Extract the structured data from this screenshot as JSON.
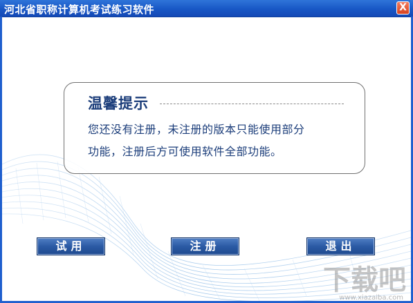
{
  "window": {
    "title": "河北省职称计算机考试练习软件",
    "close_label": "X"
  },
  "tip": {
    "title": "温馨提示",
    "line1": "您还没有注册，未注册的版本只能使用部分",
    "line2": "功能，注册后方可使用软件全部功能。"
  },
  "buttons": {
    "trial": "试用",
    "register": "注册",
    "exit": "退出"
  },
  "watermark": {
    "text": "下载吧",
    "url": "www.xiazaiba.com"
  },
  "colors": {
    "titlebar": "#1857c5",
    "button": "#2b5aa4",
    "tip_text": "#1b3d7a"
  }
}
